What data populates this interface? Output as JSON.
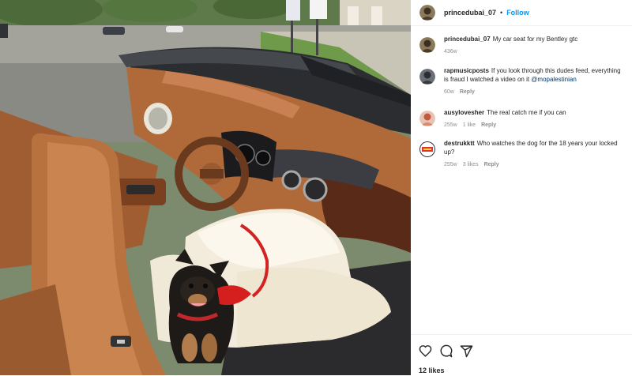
{
  "post": {
    "username": "princedubai_07",
    "separator": "•",
    "follow_label": "Follow"
  },
  "caption": {
    "username": "princedubai_07",
    "text": "My car seat for my Bentley gtc",
    "time": "436w"
  },
  "comments": [
    {
      "username": "rapmusicposts",
      "text": "If you look through this dudes feed, everything",
      "text2": "is fraud I watched a video on it",
      "mention": "@mopalestinian",
      "time": "60w",
      "reply": "Reply"
    },
    {
      "username": "ausylovesher",
      "text": "The real catch me if you can",
      "time": "255w",
      "likes": "1 like",
      "reply": "Reply"
    },
    {
      "username": "destrukktt",
      "text": "Who watches the dog for the 18 years your locked",
      "text2": "up?",
      "time": "255w",
      "likes": "3 likes",
      "reply": "Reply"
    }
  ],
  "likes_label": "12 likes",
  "icons": [
    "heart-icon",
    "comment-icon",
    "share-icon"
  ],
  "colors": {
    "accent": "#0095f6",
    "muted": "#8e8e8e",
    "leather": "#b5703f"
  }
}
